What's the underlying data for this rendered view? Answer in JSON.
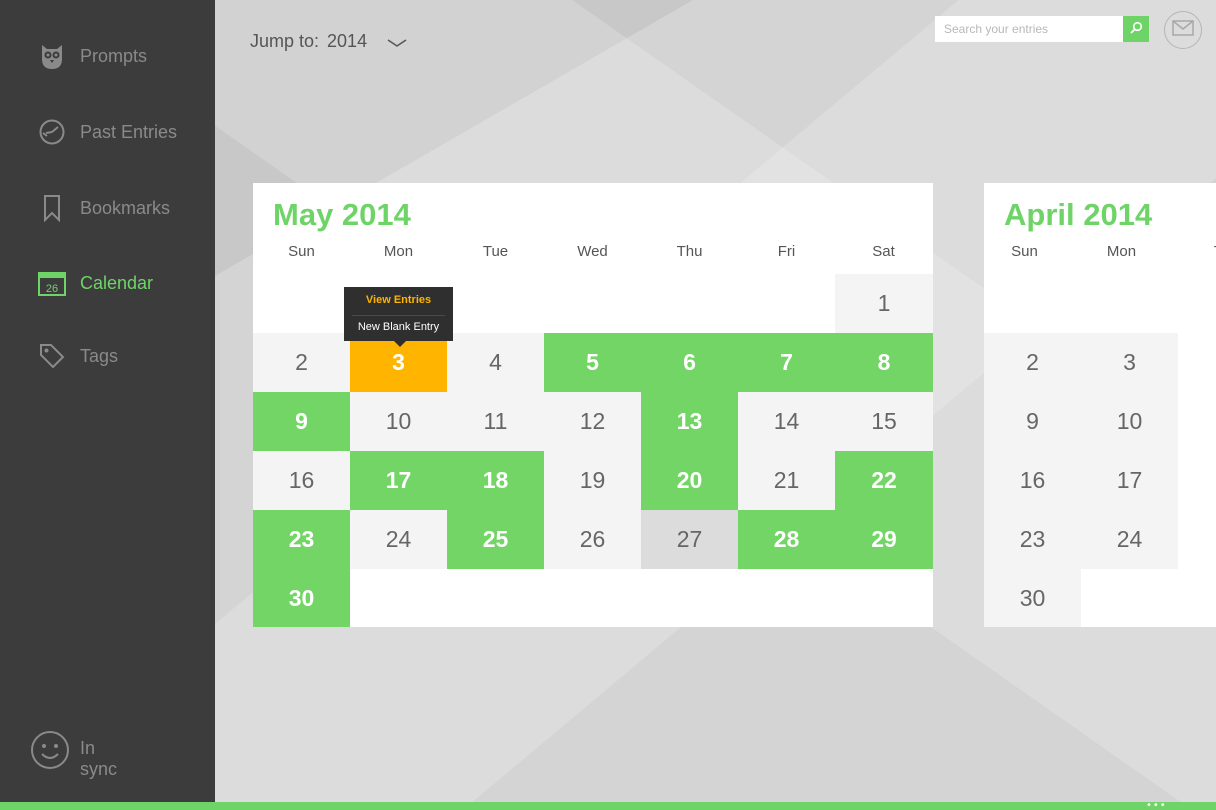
{
  "sidebar": {
    "items": [
      {
        "label": "Prompts",
        "icon": "owl-icon"
      },
      {
        "label": "Past Entries",
        "icon": "clock-icon"
      },
      {
        "label": "Bookmarks",
        "icon": "bookmark-icon"
      },
      {
        "label": "Calendar",
        "icon": "calendar-icon",
        "icon_text": "26",
        "active": true
      },
      {
        "label": "Tags",
        "icon": "tag-icon"
      }
    ],
    "sync_label": "In sync",
    "sync_icon": "smiley-icon"
  },
  "header": {
    "jump_label": "Jump to:",
    "jump_year": "2014",
    "search_placeholder": "Search your entries",
    "search_icon": "search-icon",
    "mail_icon": "mail-icon"
  },
  "colors": {
    "accent": "#6fd467",
    "entry": "#72d565",
    "selected": "#ffb400",
    "sidebar": "#3c3c3c"
  },
  "weekdays": [
    "Sun",
    "Mon",
    "Tue",
    "Wed",
    "Thu",
    "Fri",
    "Sat"
  ],
  "may": {
    "title": "May 2014",
    "days": [
      {
        "n": "1",
        "state": "plain"
      },
      {
        "n": "2",
        "state": "plain"
      },
      {
        "n": "3",
        "state": "selected"
      },
      {
        "n": "4",
        "state": "plain"
      },
      {
        "n": "5",
        "state": "entry"
      },
      {
        "n": "6",
        "state": "entry"
      },
      {
        "n": "7",
        "state": "entry"
      },
      {
        "n": "8",
        "state": "entry"
      },
      {
        "n": "9",
        "state": "entry"
      },
      {
        "n": "10",
        "state": "plain"
      },
      {
        "n": "11",
        "state": "plain"
      },
      {
        "n": "12",
        "state": "plain"
      },
      {
        "n": "13",
        "state": "entry"
      },
      {
        "n": "14",
        "state": "plain"
      },
      {
        "n": "15",
        "state": "plain"
      },
      {
        "n": "16",
        "state": "plain"
      },
      {
        "n": "17",
        "state": "entry"
      },
      {
        "n": "18",
        "state": "entry"
      },
      {
        "n": "19",
        "state": "plain"
      },
      {
        "n": "20",
        "state": "entry"
      },
      {
        "n": "21",
        "state": "plain"
      },
      {
        "n": "22",
        "state": "entry"
      },
      {
        "n": "23",
        "state": "entry"
      },
      {
        "n": "24",
        "state": "plain"
      },
      {
        "n": "25",
        "state": "entry"
      },
      {
        "n": "26",
        "state": "plain"
      },
      {
        "n": "27",
        "state": "today"
      },
      {
        "n": "28",
        "state": "entry"
      },
      {
        "n": "29",
        "state": "entry"
      },
      {
        "n": "30",
        "state": "entry"
      }
    ]
  },
  "april": {
    "title": "April 2014",
    "weekdays_visible": [
      "Sun",
      "Mon",
      "T"
    ],
    "days": [
      "2",
      "3",
      "9",
      "10",
      "16",
      "17",
      "23",
      "24",
      "30"
    ]
  },
  "tooltip": {
    "view_entries": "View Entries",
    "new_blank_entry": "New Blank Entry"
  },
  "appbar": {
    "more_label": "•••"
  }
}
